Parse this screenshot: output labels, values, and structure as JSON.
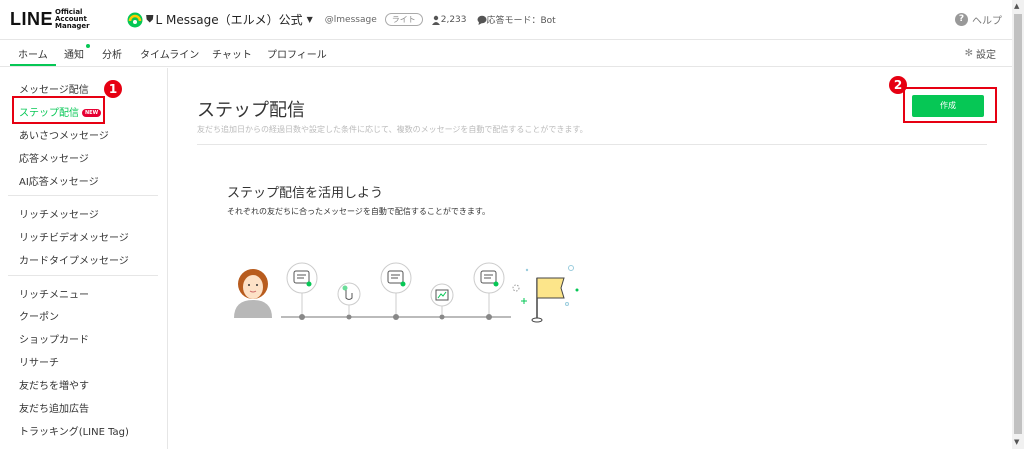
{
  "header": {
    "logo_main": "LINE",
    "logo_sub": "Official Account Manager",
    "account_name": "L Message（エルメ）公式",
    "account_id": "@lmessage",
    "plan_badge": "ライト",
    "friends_count": "2,233",
    "reply_mode": "応答モード：Bot",
    "help_label": "ヘルプ"
  },
  "tabs": [
    {
      "label": "ホーム",
      "active": true
    },
    {
      "label": "通知"
    },
    {
      "label": "分析"
    },
    {
      "label": "タイムライン"
    },
    {
      "label": "チャット"
    },
    {
      "label": "プロフィール"
    }
  ],
  "settings_label": "設定",
  "sidebar": {
    "items": [
      {
        "label": "メッセージ配信"
      },
      {
        "label": "ステップ配信",
        "active": true,
        "badge": "NEW"
      },
      {
        "label": "あいさつメッセージ"
      },
      {
        "label": "応答メッセージ"
      },
      {
        "label": "AI応答メッセージ"
      },
      {
        "label": "リッチメッセージ"
      },
      {
        "label": "リッチビデオメッセージ"
      },
      {
        "label": "カードタイプメッセージ"
      },
      {
        "label": "リッチメニュー"
      },
      {
        "label": "クーポン"
      },
      {
        "label": "ショップカード"
      },
      {
        "label": "リサーチ"
      },
      {
        "label": "友だちを増やす"
      },
      {
        "label": "友だち追加広告"
      },
      {
        "label": "トラッキング(LINE Tag)"
      }
    ]
  },
  "main": {
    "title": "ステップ配信",
    "description": "友だち追加日からの経過日数や設定した条件に応じて、複数のメッセージを自動で配信することができます。",
    "create_button": "作成",
    "promo_title": "ステップ配信を活用しよう",
    "promo_desc": "それぞれの友だちに合ったメッセージを自動で配信することができます。"
  },
  "annotations": {
    "badge1": "1",
    "badge2": "2"
  },
  "colors": {
    "accent": "#06c755",
    "highlight": "#e60012"
  }
}
